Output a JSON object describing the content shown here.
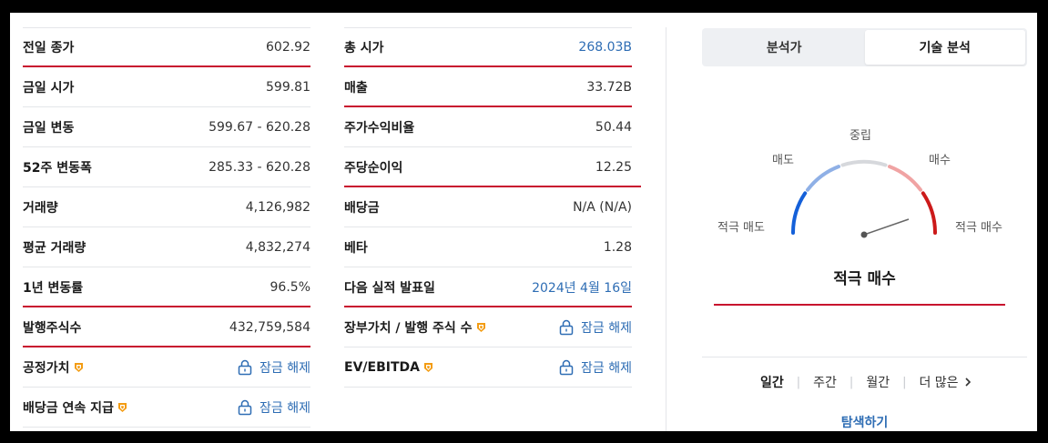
{
  "left_table": [
    {
      "label": "전일 종가",
      "value": "602.92"
    },
    {
      "label": "금일 시가",
      "value": "599.81"
    },
    {
      "label": "금일 변동",
      "value": "599.67 - 620.28"
    },
    {
      "label": "52주 변동폭",
      "value": "285.33 - 620.28"
    },
    {
      "label": "거래량",
      "value": "4,126,982"
    },
    {
      "label": "평균 거래량",
      "value": "4,832,274"
    },
    {
      "label": "1년 변동률",
      "value": "96.5%"
    },
    {
      "label": "발행주식수",
      "value": "432,759,584"
    },
    {
      "label": "공정가치",
      "value": "잠금 해제"
    },
    {
      "label": "배당금 연속 지급",
      "value": "잠금 해제"
    }
  ],
  "mid_table": [
    {
      "label": "총 시가",
      "value": "268.03B"
    },
    {
      "label": "매출",
      "value": "33.72B"
    },
    {
      "label": "주가수익비율",
      "value": "50.44"
    },
    {
      "label": "주당순이익",
      "value": "12.25"
    },
    {
      "label": "배당금",
      "value": "N/A (N/A)"
    },
    {
      "label": "베타",
      "value": "1.28"
    },
    {
      "label": "다음 실적 발표일",
      "value": "2024년 4월 16일"
    },
    {
      "label": "장부가치 / 발행 주식 수",
      "value": "잠금 해제"
    },
    {
      "label": "EV/EBITDA",
      "value": "잠금 해제"
    }
  ],
  "tabs": {
    "analyst": "분석가",
    "technical": "기술 분석"
  },
  "gauge": {
    "labels": {
      "strong_sell": "적극 매도",
      "sell": "매도",
      "neutral": "중립",
      "buy": "매수",
      "strong_buy": "적극 매수"
    },
    "result": "적극 매수",
    "colors": {
      "strong_sell": "#1460d9",
      "sell": "#8fb0e6",
      "neutral": "#d6d8dc",
      "buy": "#f0a3a3",
      "strong_buy": "#cc1a1a"
    }
  },
  "periods": {
    "daily": "일간",
    "weekly": "주간",
    "monthly": "월간",
    "more": "더 많은"
  },
  "explore": "탐색하기",
  "colors": {
    "link": "#2e6db4",
    "accent_line": "#c8102e"
  }
}
